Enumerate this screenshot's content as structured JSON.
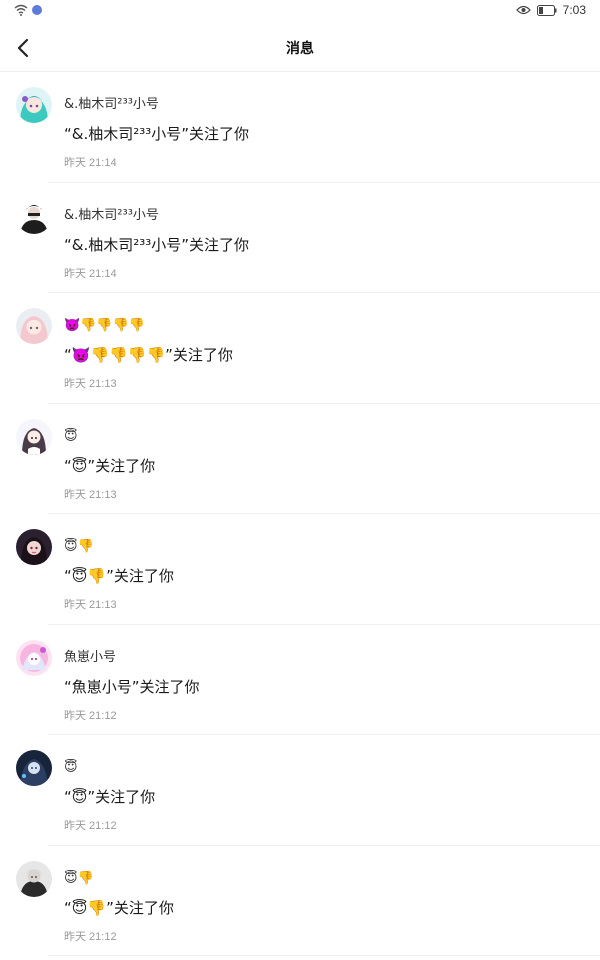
{
  "status_bar": {
    "time": "7:03",
    "icons": [
      "wifi-icon",
      "notification-icon",
      "eye-icon",
      "battery-icon"
    ]
  },
  "header": {
    "title": "消息",
    "back_icon": "chevron-left-icon"
  },
  "messages": [
    {
      "sender": "&.柚木司²³³小号",
      "text": "“&.柚木司²³³小号”关注了你",
      "time": "昨天 21:14",
      "avatar": "avatar-teal-hair"
    },
    {
      "sender": "&.柚木司²³³小号",
      "text": "“&.柚木司²³³小号”关注了你",
      "time": "昨天 21:14",
      "avatar": "avatar-dark-figure"
    },
    {
      "sender": "👿👎👎👎👎",
      "text": "“👿👎👎👎👎”关注了你",
      "time": "昨天 21:13",
      "avatar": "avatar-pink-hair"
    },
    {
      "sender": "😇",
      "text": "“😇”关注了你",
      "time": "昨天 21:13",
      "avatar": "avatar-light-girl"
    },
    {
      "sender": "😇👎",
      "text": "“😇👎”关注了你",
      "time": "昨天 21:13",
      "avatar": "avatar-dark-girl"
    },
    {
      "sender": "魚崽小号",
      "text": "“魚崽小号”关注了你",
      "time": "昨天 21:12",
      "avatar": "avatar-pink-anime"
    },
    {
      "sender": "😇",
      "text": "“😇”关注了你",
      "time": "昨天 21:12",
      "avatar": "avatar-blue-anime"
    },
    {
      "sender": "😇👎",
      "text": "“😇👎”关注了你",
      "time": "昨天 21:12",
      "avatar": "avatar-gray-figure"
    }
  ]
}
